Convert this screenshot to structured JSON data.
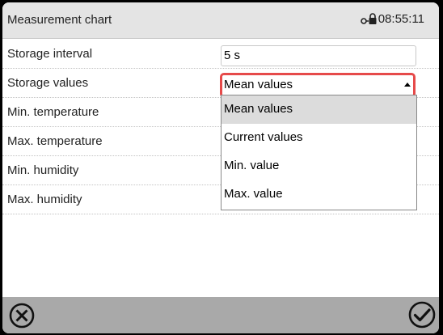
{
  "header": {
    "title": "Measurement chart",
    "time": "08:55:11",
    "status_icon": "lock-key-icon"
  },
  "settings": [
    {
      "label": "Storage interval",
      "value": "5 s"
    },
    {
      "label": "Storage values",
      "value": "Mean values"
    },
    {
      "label": "Min. temperature"
    },
    {
      "label": "Max. temperature"
    },
    {
      "label": "Min. humidity"
    },
    {
      "label": "Max. humidity"
    }
  ],
  "dropdown": {
    "options": [
      "Mean values",
      "Current values",
      "Min. value",
      "Max. value"
    ],
    "selected": "Mean values"
  },
  "footer": {
    "cancel_icon": "cancel-x-icon",
    "confirm_icon": "confirm-check-icon"
  },
  "colors": {
    "highlight_border": "#e64a4a",
    "header_bg": "#e4e4e4",
    "footer_bg": "#a9a9a9",
    "selected_option_bg": "#dcdcdc"
  }
}
